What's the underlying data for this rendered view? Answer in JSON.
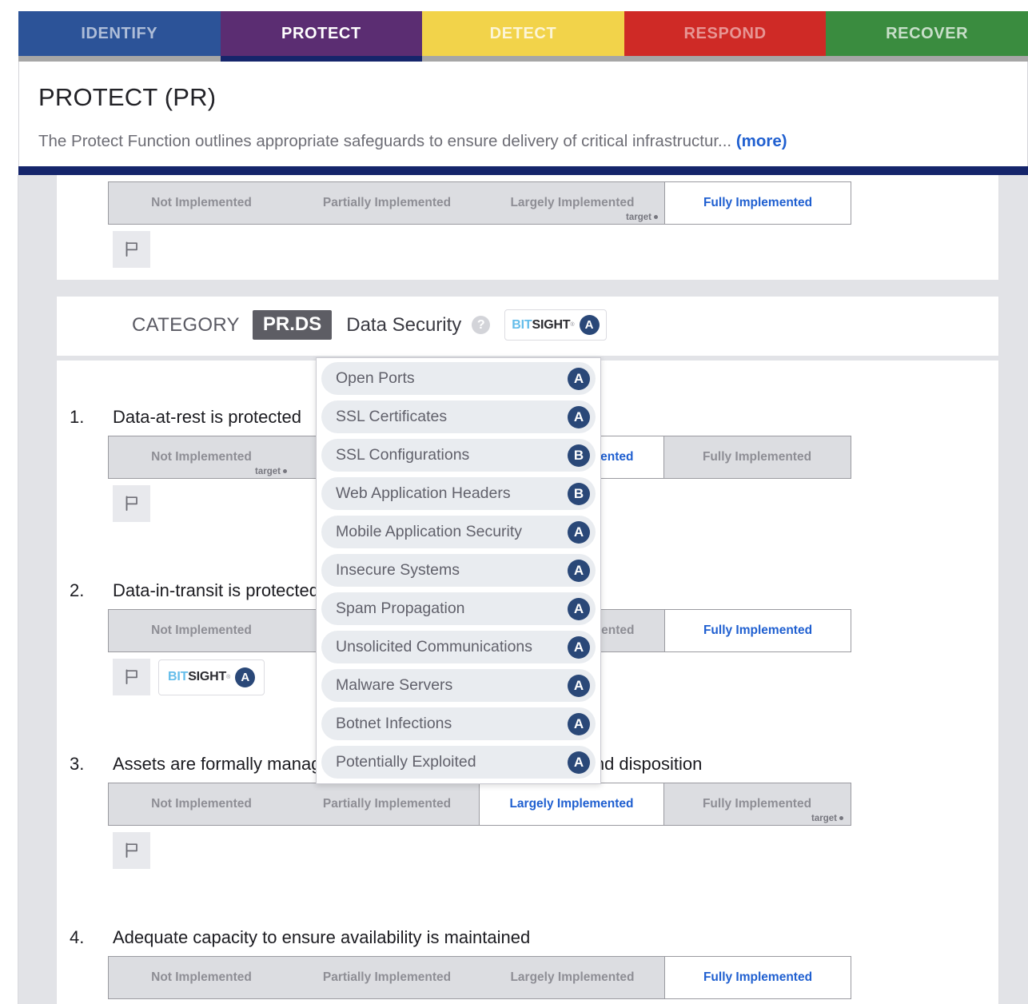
{
  "framework_tabs": [
    {
      "label": "IDENTIFY",
      "bg": "#2c5398",
      "fg": "rgba(255,255,255,0.62)",
      "active": false
    },
    {
      "label": "PROTECT",
      "bg": "#5b2d72",
      "fg": "#ffffff",
      "active": true
    },
    {
      "label": "DETECT",
      "bg": "#f2d34a",
      "fg": "rgba(255,255,255,0.78)",
      "active": false
    },
    {
      "label": "RESPOND",
      "bg": "#cf2a26",
      "fg": "rgba(255,255,255,0.50)",
      "active": false
    },
    {
      "label": "RECOVER",
      "bg": "#3a8c3f",
      "fg": "rgba(255,255,255,0.72)",
      "active": false
    }
  ],
  "header": {
    "title": "PROTECT (PR)",
    "description": "The Protect Function outlines appropriate safeguards to ensure delivery of critical infrastructur...",
    "more_label": "(more)",
    "accent_color": "#15256b"
  },
  "seg_labels": [
    "Not Implemented",
    "Partially Implemented",
    "Largely Implemented",
    "Fully Implemented"
  ],
  "target_label": "target",
  "category": {
    "label": "CATEGORY",
    "code": "PR.DS",
    "name": "Data Security",
    "help_icon": "question-mark-icon",
    "badge": {
      "bit": "BIT",
      "sight": "SIGHT",
      "tm": "®",
      "grade": "A"
    }
  },
  "dropdown": {
    "items": [
      {
        "label": "Open Ports",
        "grade": "A"
      },
      {
        "label": "SSL Certificates",
        "grade": "A"
      },
      {
        "label": "SSL Configurations",
        "grade": "B"
      },
      {
        "label": "Web Application Headers",
        "grade": "B"
      },
      {
        "label": "Mobile Application Security",
        "grade": "A"
      },
      {
        "label": "Insecure Systems",
        "grade": "A"
      },
      {
        "label": "Spam Propagation",
        "grade": "A"
      },
      {
        "label": "Unsolicited Communications",
        "grade": "A"
      },
      {
        "label": "Malware Servers",
        "grade": "A"
      },
      {
        "label": "Botnet Infections",
        "grade": "A"
      },
      {
        "label": "Potentially Exploited",
        "grade": "A"
      }
    ]
  },
  "questions": [
    {
      "number": "",
      "text": "",
      "selected": 3,
      "target": 2,
      "has_badge": false
    },
    {
      "number": "1.",
      "text": "Data-at-rest is protected",
      "selected": 2,
      "target": 0,
      "has_badge": false
    },
    {
      "number": "2.",
      "text": "Data-in-transit is protected",
      "selected": 3,
      "target": -1,
      "has_badge": true,
      "badge": {
        "bit": "BIT",
        "sight": "SIGHT",
        "tm": "®",
        "grade": "A"
      }
    },
    {
      "number": "3.",
      "text": "Assets are formally managed throughout removal, transfers, and disposition",
      "selected": 2,
      "target": 3,
      "has_badge": false
    },
    {
      "number": "4.",
      "text": "Adequate capacity to ensure availability is maintained",
      "selected": 3,
      "target": -1,
      "has_badge": false
    }
  ]
}
